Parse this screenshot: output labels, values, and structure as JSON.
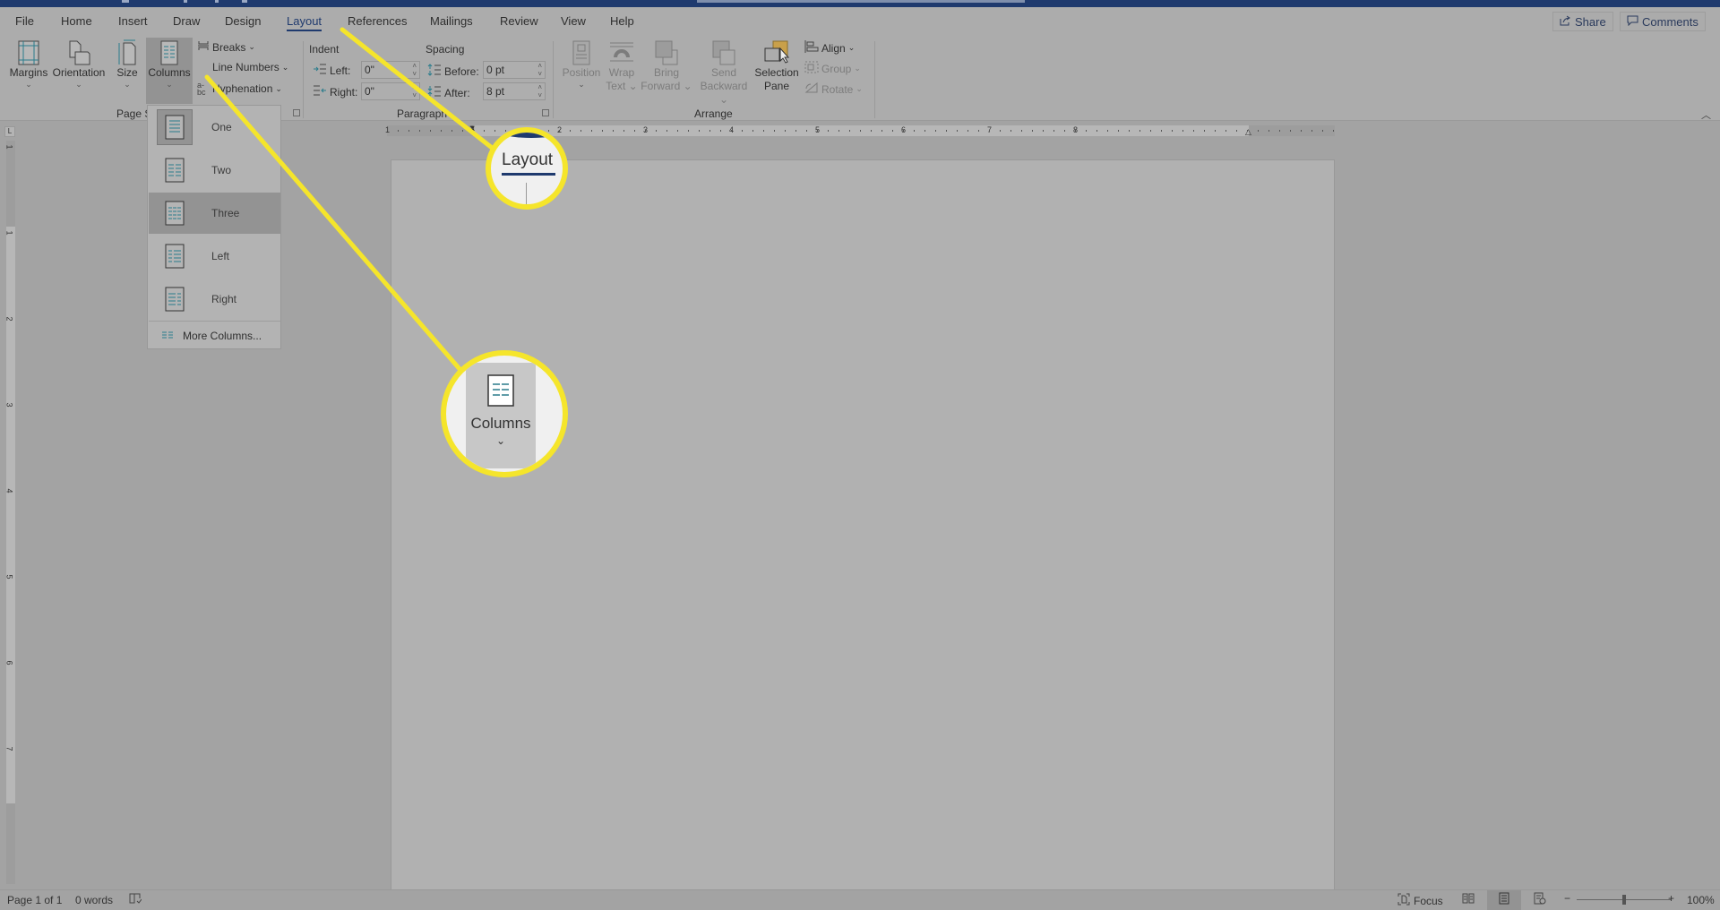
{
  "tabs": [
    {
      "label": "File",
      "active": false
    },
    {
      "label": "Home",
      "active": false
    },
    {
      "label": "Insert",
      "active": false
    },
    {
      "label": "Draw",
      "active": false
    },
    {
      "label": "Design",
      "active": false
    },
    {
      "label": "Layout",
      "active": true
    },
    {
      "label": "References",
      "active": false
    },
    {
      "label": "Mailings",
      "active": false
    },
    {
      "label": "Review",
      "active": false
    },
    {
      "label": "View",
      "active": false
    },
    {
      "label": "Help",
      "active": false
    }
  ],
  "top_buttons": {
    "share": "Share",
    "comments": "Comments"
  },
  "ribbon": {
    "page_setup": {
      "label": "Page Setup",
      "margins": "Margins",
      "orientation": "Orientation",
      "size": "Size",
      "columns": "Columns",
      "breaks": "Breaks",
      "line_numbers": "Line Numbers",
      "hyphenation": "Hyphenation"
    },
    "paragraph": {
      "label": "Paragraph",
      "indent_label": "Indent",
      "spacing_label": "Spacing",
      "left_label": "Left:",
      "left_value": "0\"",
      "right_label": "Right:",
      "right_value": "0\"",
      "before_label": "Before:",
      "before_value": "0 pt",
      "after_label": "After:",
      "after_value": "8 pt"
    },
    "arrange": {
      "label": "Arrange",
      "position": "Position",
      "wrap_text_1": "Wrap",
      "wrap_text_2": "Text",
      "bring_forward_1": "Bring",
      "bring_forward_2": "Forward",
      "send_backward_1": "Send",
      "send_backward_2": "Backward",
      "selection_pane_1": "Selection",
      "selection_pane_2": "Pane",
      "align": "Align",
      "group": "Group",
      "rotate": "Rotate"
    }
  },
  "columns_menu": {
    "items": [
      {
        "label": "One",
        "checked": true,
        "hover": false
      },
      {
        "label": "Two",
        "checked": false,
        "hover": false
      },
      {
        "label": "Three",
        "checked": false,
        "hover": true
      },
      {
        "label": "Left",
        "checked": false,
        "hover": false
      },
      {
        "label": "Right",
        "checked": false,
        "hover": false
      }
    ],
    "more": "More Columns..."
  },
  "ruler": {
    "h_numbers": [
      "1",
      "1",
      "2",
      "3",
      "4",
      "5",
      "6",
      "7",
      "8"
    ],
    "v_numbers": [
      "1",
      "1",
      "2",
      "3",
      "4",
      "5",
      "6",
      "7"
    ]
  },
  "callouts": {
    "layout_label": "Layout",
    "columns_label": "Columns",
    "color": "#f5e52b"
  },
  "status": {
    "page": "Page 1 of 1",
    "words": "0 words",
    "focus": "Focus",
    "zoom": "100%"
  },
  "colors": {
    "accent": "#1f3a6e",
    "highlight": "#f5e52b",
    "icon_teal": "#2a7c8c",
    "selection_pane_icon": "#c9a04a"
  }
}
